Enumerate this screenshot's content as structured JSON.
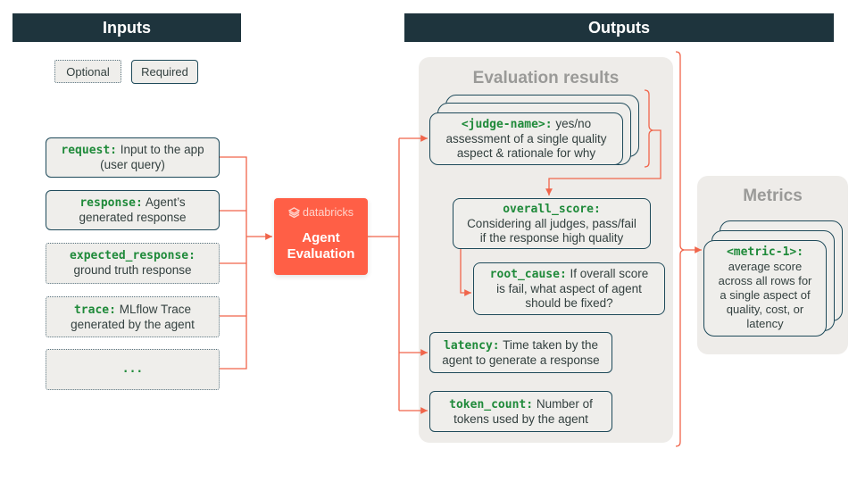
{
  "headers": {
    "inputs": "Inputs",
    "outputs": "Outputs"
  },
  "legend": {
    "optional": "Optional",
    "required": "Required"
  },
  "inputs": [
    {
      "code": "request:",
      "text": "Input to the app (user query)",
      "required": true
    },
    {
      "code": "response:",
      "text": "Agent’s generated response",
      "required": true
    },
    {
      "code": "expected_response:",
      "text": "ground truth response",
      "required": false
    },
    {
      "code": "trace:",
      "text": "MLflow Trace generated by the agent",
      "required": false
    },
    {
      "code": "...",
      "text": "",
      "required": false
    }
  ],
  "agent": {
    "brand": "databricks",
    "title_line1": "Agent",
    "title_line2": "Evaluation",
    "icon": "databricks-logo-icon"
  },
  "evaluation_results": {
    "title": "Evaluation results",
    "judge": {
      "code": "<judge-name>:",
      "text_line1": "yes/no",
      "text_line2": "assessment of a single quality",
      "text_line3": "aspect & rationale for why"
    },
    "overall_score": {
      "code": "overall_score:",
      "text_line1": "Considering all judges, pass/fail",
      "text_line2": "if the response high quality"
    },
    "root_cause": {
      "code": "root_cause:",
      "text_line1": "If overall score",
      "text_line2": "is fail, what aspect of agent",
      "text_line3": "should be fixed?"
    },
    "latency": {
      "code": "latency:",
      "text_line1": "Time taken by the",
      "text_line2": "agent to generate a response"
    },
    "token_count": {
      "code": "token_count:",
      "text_line1": "Number of",
      "text_line2": "tokens used by the agent"
    }
  },
  "metrics": {
    "title": "Metrics",
    "metric": {
      "code": "<metric-1>:",
      "lines": [
        "average score",
        "across all rows for",
        "a single aspect of",
        "quality, cost, or",
        "latency"
      ]
    }
  },
  "colors": {
    "header_bg": "#1e343d",
    "accent": "#ff5f46",
    "code_green": "#1f8a3a",
    "border": "#1e4a5a",
    "panel_bg": "#eeece9"
  }
}
